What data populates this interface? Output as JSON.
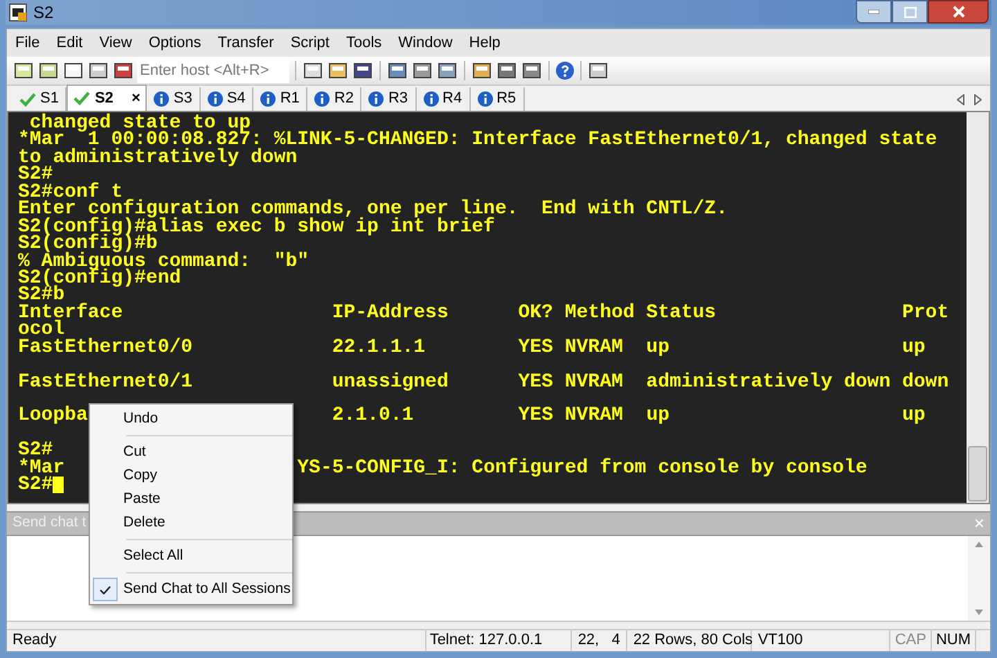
{
  "window": {
    "title": "S2"
  },
  "menu_bar": [
    "File",
    "Edit",
    "View",
    "Options",
    "Transfer",
    "Script",
    "Tools",
    "Window",
    "Help"
  ],
  "toolbar": {
    "host_field": {
      "placeholder": "Enter host <Alt+R>"
    }
  },
  "tabs": [
    {
      "label": "S1",
      "selected": false,
      "kind": "connected"
    },
    {
      "label": "S2",
      "selected": true,
      "kind": "connected",
      "close": "×"
    },
    {
      "label": "S3",
      "selected": false,
      "kind": "idle"
    },
    {
      "label": "S4",
      "selected": false,
      "kind": "idle"
    },
    {
      "label": "R1",
      "selected": false,
      "kind": "idle"
    },
    {
      "label": "R2",
      "selected": false,
      "kind": "idle"
    },
    {
      "label": "R3",
      "selected": false,
      "kind": "idle"
    },
    {
      "label": "R4",
      "selected": false,
      "kind": "idle"
    },
    {
      "label": "R5",
      "selected": false,
      "kind": "idle"
    }
  ],
  "terminal": {
    "lines": [
      {
        "kind": "text",
        "text": " changed state to up"
      },
      {
        "kind": "text",
        "text": "*Mar  1 00:00:08.827: %LINK-5-CHANGED: Interface FastEthernet0/1, changed state"
      },
      {
        "kind": "text",
        "text": "to administratively down"
      },
      {
        "kind": "text",
        "text": "S2#"
      },
      {
        "kind": "text",
        "text": "S2#conf t"
      },
      {
        "kind": "text",
        "text": "Enter configuration commands, one per line.  End with CNTL/Z."
      },
      {
        "kind": "text",
        "text": "S2(config)#alias exec b show ip int brief"
      },
      {
        "kind": "text",
        "text": "S2(config)#b"
      },
      {
        "kind": "text",
        "text": "% Ambiguous command:  \"b\""
      },
      {
        "kind": "text",
        "text": "S2(config)#end"
      },
      {
        "kind": "text",
        "text": "S2#b"
      },
      {
        "kind": "text",
        "text": "Interface                  IP-Address      OK? Method Status                Prot"
      },
      {
        "kind": "text",
        "text": "ocol"
      },
      {
        "kind": "text",
        "text": "FastEthernet0/0            22.1.1.1        YES NVRAM  up                    up"
      },
      {
        "kind": "blank"
      },
      {
        "kind": "text",
        "text": "FastEthernet0/1            unassigned      YES NVRAM  administratively down down"
      },
      {
        "kind": "blank"
      },
      {
        "kind": "text",
        "text": "Loopba",
        "tail": "                     2.1.0.1         YES NVRAM  up                    up"
      },
      {
        "kind": "blank"
      },
      {
        "kind": "text",
        "text": "S2#"
      },
      {
        "kind": "text",
        "text": "*Mar",
        "tail": "                    YS-5-CONFIG_I: Configured from console by console"
      },
      {
        "kind": "text",
        "text": "S2#",
        "cursor": true
      }
    ]
  },
  "chat": {
    "label": "Send chat t",
    "close": "×"
  },
  "context_menu": [
    {
      "kind": "item",
      "label": "Undo",
      "checked": false
    },
    {
      "kind": "separator"
    },
    {
      "kind": "item",
      "label": "Cut",
      "checked": false
    },
    {
      "kind": "item",
      "label": "Copy",
      "checked": false
    },
    {
      "kind": "item",
      "label": "Paste",
      "checked": false
    },
    {
      "kind": "item",
      "label": "Delete",
      "checked": false
    },
    {
      "kind": "separator"
    },
    {
      "kind": "item",
      "label": "Select All",
      "checked": false
    },
    {
      "kind": "separator"
    },
    {
      "kind": "item",
      "label": "Send Chat to All Sessions",
      "checked": true
    }
  ],
  "status_bar": [
    {
      "kind": "text",
      "text": "Ready"
    },
    {
      "kind": "text",
      "text": "Telnet: 127.0.0.1"
    },
    {
      "kind": "text",
      "text": "22,   4"
    },
    {
      "kind": "text",
      "text": "22 Rows, 80 Cols"
    },
    {
      "kind": "text",
      "text": "VT100"
    },
    {
      "kind": "indicator",
      "text": "CAP",
      "on": false
    },
    {
      "kind": "indicator",
      "text": "NUM",
      "on": true
    }
  ]
}
